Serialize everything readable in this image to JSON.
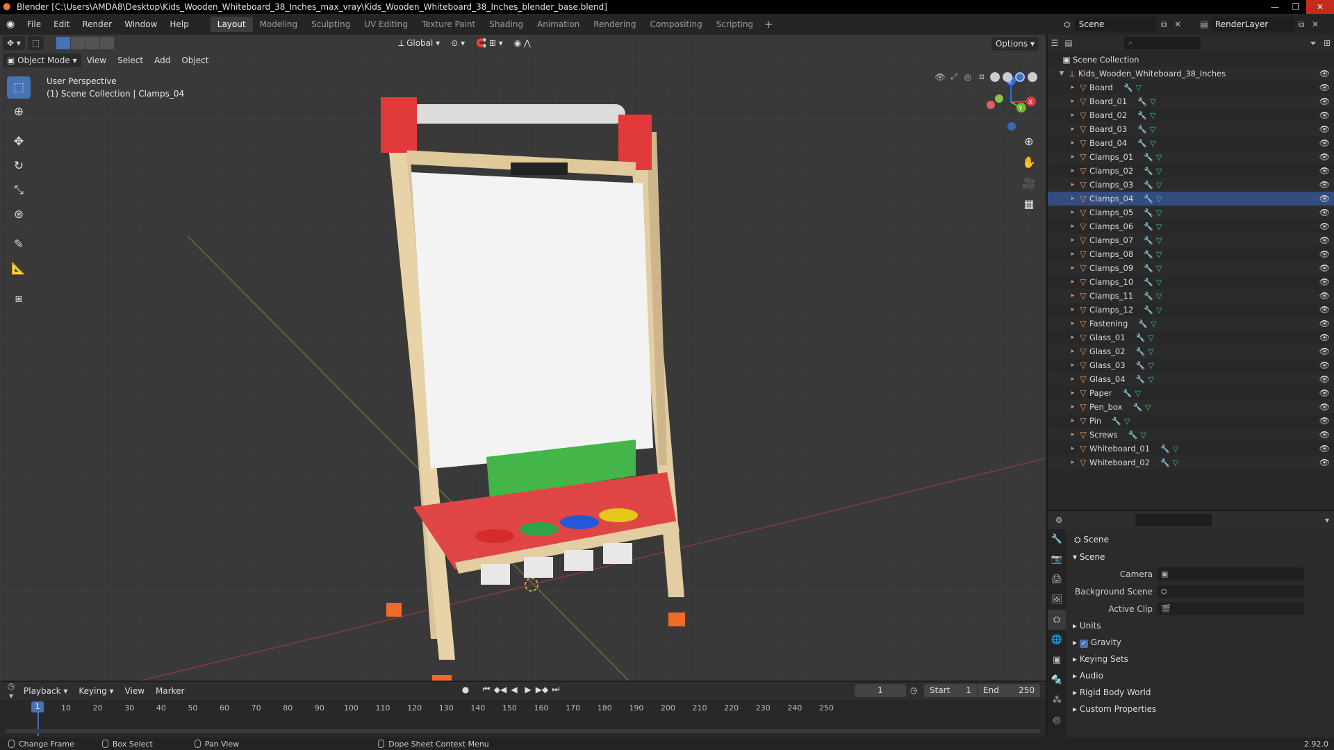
{
  "window": {
    "title": "Blender [C:\\Users\\AMDA8\\Desktop\\Kids_Wooden_Whiteboard_38_Inches_max_vray\\Kids_Wooden_Whiteboard_38_Inches_blender_base.blend]"
  },
  "menu": [
    "File",
    "Edit",
    "Render",
    "Window",
    "Help"
  ],
  "workspaces": [
    {
      "label": "Layout",
      "active": true
    },
    {
      "label": "Modeling"
    },
    {
      "label": "Sculpting"
    },
    {
      "label": "UV Editing"
    },
    {
      "label": "Texture Paint"
    },
    {
      "label": "Shading"
    },
    {
      "label": "Animation"
    },
    {
      "label": "Rendering"
    },
    {
      "label": "Compositing"
    },
    {
      "label": "Scripting"
    }
  ],
  "scene_selector": {
    "value": "Scene"
  },
  "renderlayer_selector": {
    "value": "RenderLayer"
  },
  "viewport": {
    "transform_orientation": "Global",
    "options_label": "Options",
    "mode": "Object Mode",
    "header_menus": [
      "View",
      "Select",
      "Add",
      "Object"
    ],
    "info_line1": "User Perspective",
    "info_line2": "(1) Scene Collection | Clamps_04",
    "gizmo": {
      "x": "X",
      "y": "Y",
      "z": "Z"
    }
  },
  "outliner": {
    "root": "Scene Collection",
    "collection": "Kids_Wooden_Whiteboard_38_Inches",
    "selected": "Clamps_04",
    "items": [
      "Board",
      "Board_01",
      "Board_02",
      "Board_03",
      "Board_04",
      "Clamps_01",
      "Clamps_02",
      "Clamps_03",
      "Clamps_04",
      "Clamps_05",
      "Clamps_06",
      "Clamps_07",
      "Clamps_08",
      "Clamps_09",
      "Clamps_10",
      "Clamps_11",
      "Clamps_12",
      "Fastening",
      "Glass_01",
      "Glass_02",
      "Glass_03",
      "Glass_04",
      "Paper",
      "Pen_box",
      "Pin",
      "Screws",
      "Whiteboard_01",
      "Whiteboard_02"
    ]
  },
  "properties": {
    "title": "Scene",
    "panel": "Scene",
    "fields": [
      {
        "label": "Camera",
        "value": ""
      },
      {
        "label": "Background Scene",
        "value": ""
      },
      {
        "label": "Active Clip",
        "value": ""
      }
    ],
    "subpanels": [
      {
        "label": "Units"
      },
      {
        "label": "Gravity",
        "checked": true
      },
      {
        "label": "Keying Sets"
      },
      {
        "label": "Audio"
      },
      {
        "label": "Rigid Body World"
      },
      {
        "label": "Custom Properties"
      }
    ]
  },
  "timeline": {
    "menus": [
      "Playback",
      "Keying",
      "View",
      "Marker"
    ],
    "current_frame": "1",
    "start_label": "Start",
    "start": "1",
    "end_label": "End",
    "end": "250",
    "ticks": [
      "1",
      "10",
      "20",
      "30",
      "40",
      "50",
      "60",
      "70",
      "80",
      "90",
      "100",
      "110",
      "120",
      "130",
      "140",
      "150",
      "160",
      "170",
      "180",
      "190",
      "200",
      "210",
      "220",
      "230",
      "240",
      "250"
    ]
  },
  "statusbar": {
    "items": [
      "Change Frame",
      "Box Select",
      "Pan View",
      "Dope Sheet Context Menu"
    ],
    "version": "2.92.0"
  },
  "colors": {
    "accent": "#4772b3",
    "selected_row": "#334d80",
    "object_icon": "#f29b57",
    "mesh_icon": "#37c98e",
    "modifier_icon": "#6aa6e2"
  }
}
